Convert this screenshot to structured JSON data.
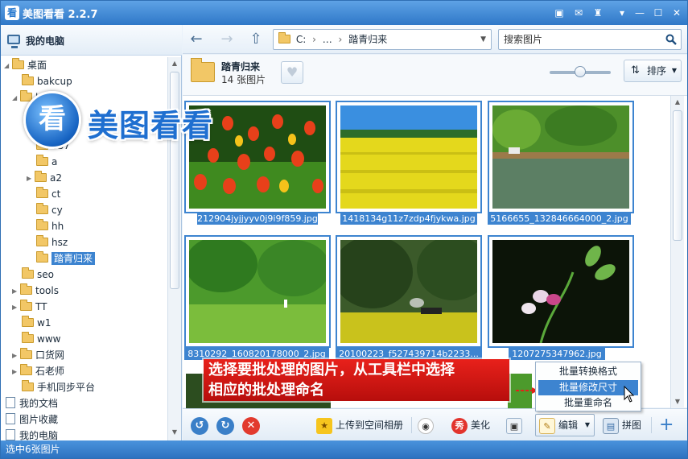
{
  "app": {
    "logo_char": "看",
    "title": "美图看看 2.2.7"
  },
  "brand": {
    "circle_char": "看",
    "text": "美图看看"
  },
  "tree": {
    "header": "我的电脑",
    "items": [
      {
        "label": "桌面"
      },
      {
        "label": "bakcup"
      },
      {
        "label": "b"
      },
      {
        "label": "bb"
      },
      {
        "label": "bb7"
      },
      {
        "label": "a"
      },
      {
        "label": "a2"
      },
      {
        "label": "ct"
      },
      {
        "label": "cy"
      },
      {
        "label": "hh"
      },
      {
        "label": "hsz"
      },
      {
        "label": "踏青归来"
      },
      {
        "label": "seo"
      },
      {
        "label": "tools"
      },
      {
        "label": "TT"
      },
      {
        "label": "w1"
      },
      {
        "label": "www"
      },
      {
        "label": "口货网"
      },
      {
        "label": "石老师"
      },
      {
        "label": "手机同步平台"
      },
      {
        "label": "我的文档"
      },
      {
        "label": "图片收藏"
      },
      {
        "label": "我的电脑"
      }
    ]
  },
  "nav": {
    "address_drive": "C:",
    "address_ellipsis": "…",
    "address_folder": "踏青归来",
    "search_placeholder": "搜索图片"
  },
  "folder": {
    "name": "踏青归来",
    "count": "14 张图片",
    "zoom_level": 0.5,
    "sort_label": "排序"
  },
  "thumbnails": [
    {
      "caption": "212904jyjjyyv0j9i9f859.jpg"
    },
    {
      "caption": "1418134g11z7zdp4fjykwa.jpg"
    },
    {
      "caption": "5166655_132846664000_2.jpg"
    },
    {
      "caption": "8310292_160820178000_2.jpg"
    },
    {
      "caption": "20100223_f527439714b2233..."
    },
    {
      "caption": "1207275347962.jpg"
    }
  ],
  "callout": {
    "line1": "选择要批处理的图片，从工具栏中选择",
    "line2": "相应的批处理命名"
  },
  "context_menu": {
    "items": [
      "批量转换格式",
      "批量修改尺寸",
      "批量重命名"
    ]
  },
  "toolbar": {
    "upload": "上传到空间相册",
    "beautify_icon": "秀",
    "beautify": "美化",
    "edit": "编辑",
    "collage": "拼图",
    "add": "+"
  },
  "status": {
    "text": "选中6张图片"
  }
}
